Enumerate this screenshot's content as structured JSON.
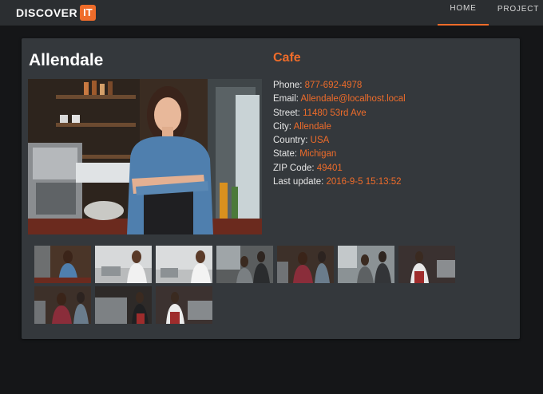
{
  "header": {
    "logo_word": "DISCOVER",
    "logo_badge": "IT",
    "nav": [
      {
        "label": "HOME",
        "active": true
      },
      {
        "label": "PROJECT",
        "active": false
      }
    ]
  },
  "place": {
    "name": "Allendale",
    "category": "Cafe",
    "fields": [
      {
        "label": "Phone: ",
        "value": "877-692-4978"
      },
      {
        "label": "Email: ",
        "value": "Allendale@localhost.local"
      },
      {
        "label": "Street: ",
        "value": "11480 53rd Ave"
      },
      {
        "label": "City: ",
        "value": "Allendale"
      },
      {
        "label": "Country: ",
        "value": "USA"
      },
      {
        "label": "State: ",
        "value": "Michigan"
      },
      {
        "label": "ZIP Code: ",
        "value": "49401"
      },
      {
        "label": "Last update: ",
        "value": "2016-9-5 15:13:52"
      }
    ]
  },
  "colors": {
    "accent": "#ef6c2a",
    "card": "#34383c",
    "background": "#151618",
    "topbar": "#2b2e31"
  },
  "gallery_count": 11
}
